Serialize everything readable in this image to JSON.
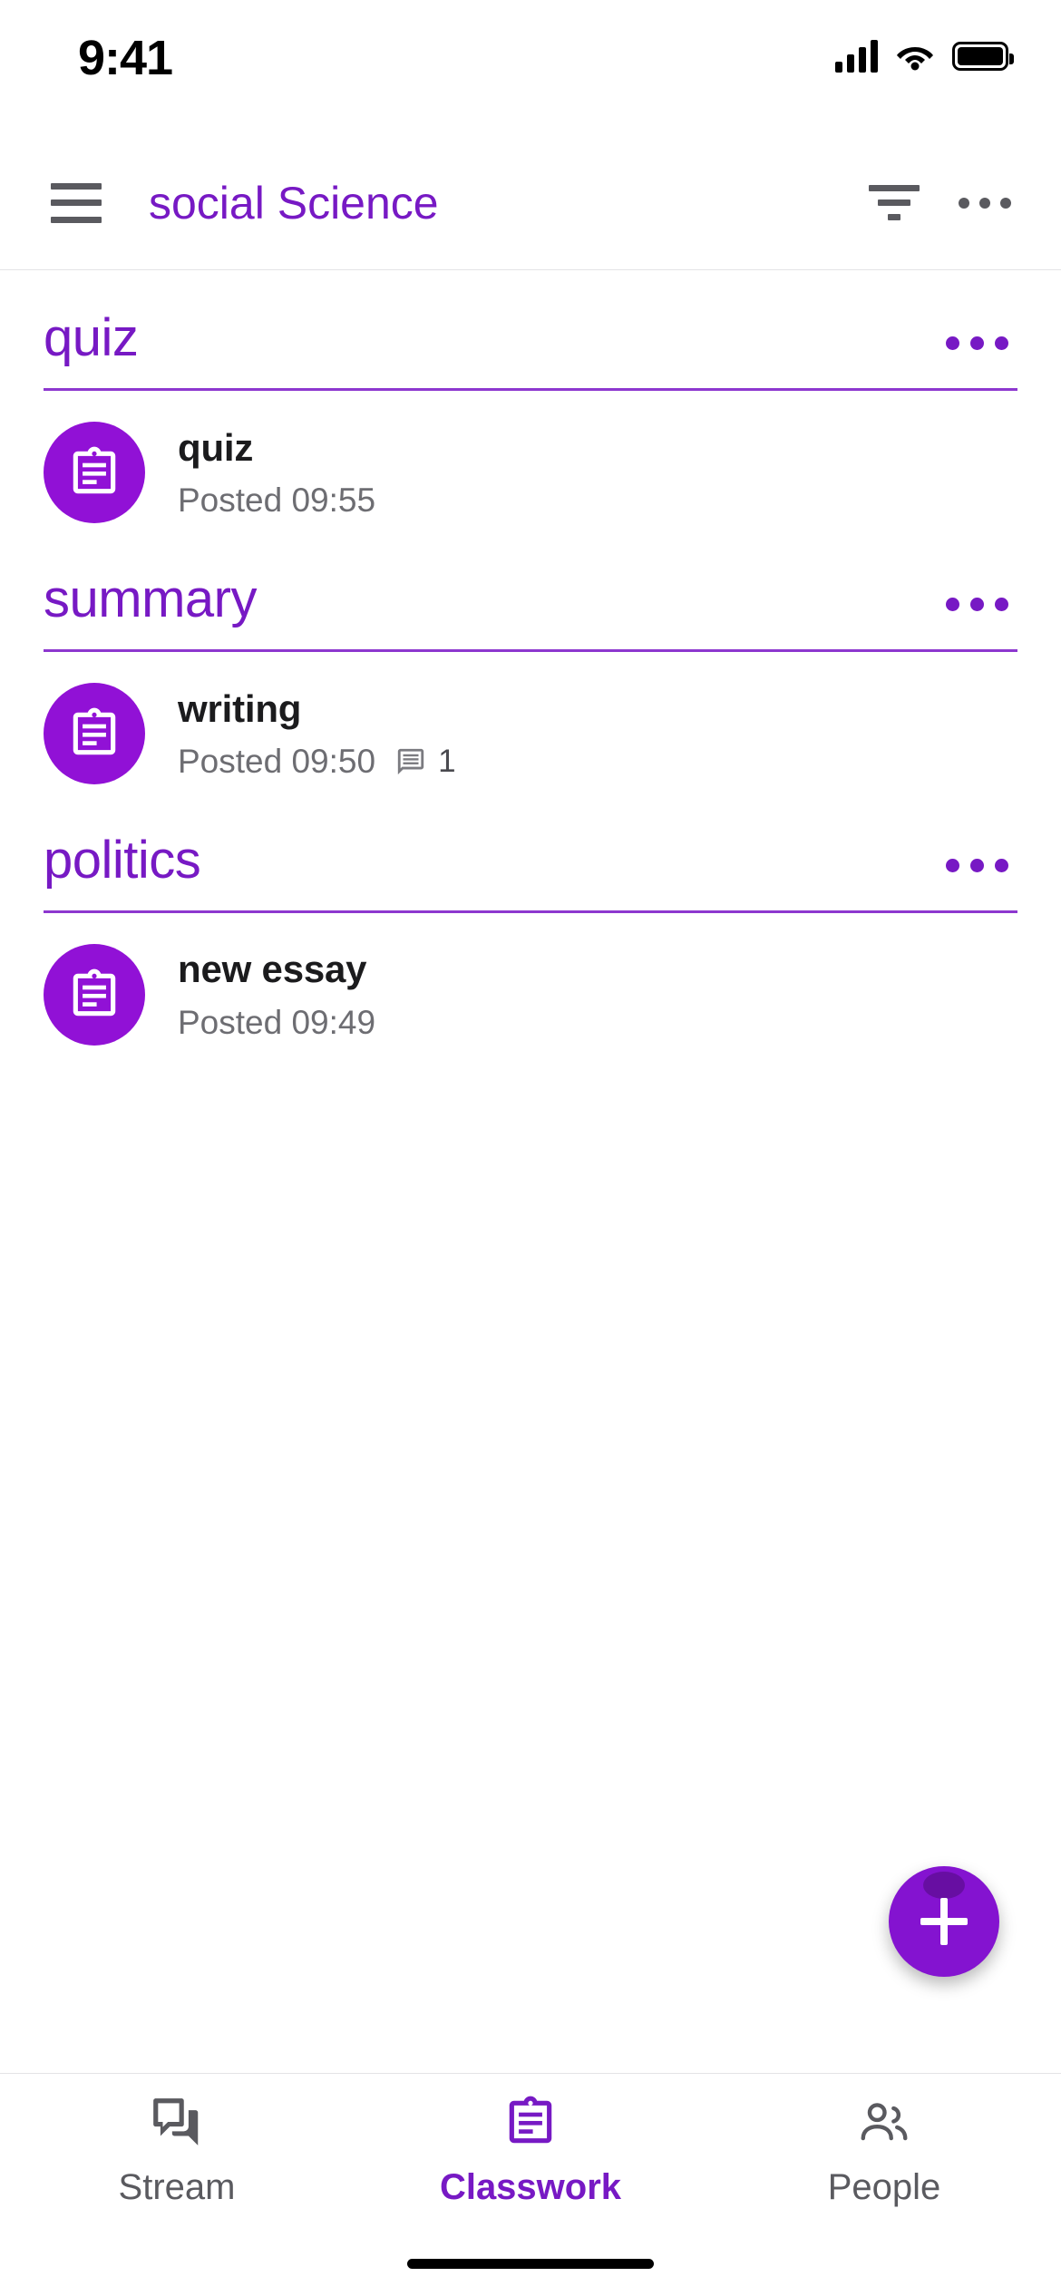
{
  "status_bar": {
    "time": "9:41",
    "signal_icon": "cellular-signal-icon",
    "wifi_icon": "wifi-icon",
    "battery_icon": "battery-full-icon"
  },
  "app_bar": {
    "menu_icon": "hamburger-menu-icon",
    "title": "social Science",
    "filter_icon": "filter-sort-icon",
    "overflow_icon": "overflow-menu-icon",
    "title_color": "#7719c4"
  },
  "colors": {
    "purple": "#7719c4",
    "avatar_purple": "#9111d6",
    "rule_purple": "#8d37cf",
    "fab_purple": "#8413d0",
    "text_primary": "#1b1b1d",
    "text_secondary": "#6d6d72",
    "icon_gray": "#5a5a5f"
  },
  "topics": [
    {
      "title": "quiz",
      "overflow_icon": "overflow-menu-icon",
      "items": [
        {
          "icon": "assignment-clipboard-icon",
          "title": "quiz",
          "posted": "Posted 09:55",
          "comments": null
        }
      ]
    },
    {
      "title": "summary",
      "overflow_icon": "overflow-menu-icon",
      "items": [
        {
          "icon": "assignment-clipboard-icon",
          "title": "writing",
          "posted": "Posted 09:50",
          "comments": "1",
          "comment_icon": "comment-icon"
        }
      ]
    },
    {
      "title": "politics",
      "overflow_icon": "overflow-menu-icon",
      "items": [
        {
          "icon": "assignment-clipboard-icon",
          "title": "new essay",
          "posted": "Posted 09:49",
          "comments": null
        }
      ]
    }
  ],
  "fab": {
    "icon": "plus-icon",
    "label": "+"
  },
  "bottom_nav": {
    "items": [
      {
        "label": "Stream",
        "icon": "stream-chat-icon",
        "active": false
      },
      {
        "label": "Classwork",
        "icon": "classwork-clipboard-icon",
        "active": true
      },
      {
        "label": "People",
        "icon": "people-icon",
        "active": false
      }
    ]
  }
}
